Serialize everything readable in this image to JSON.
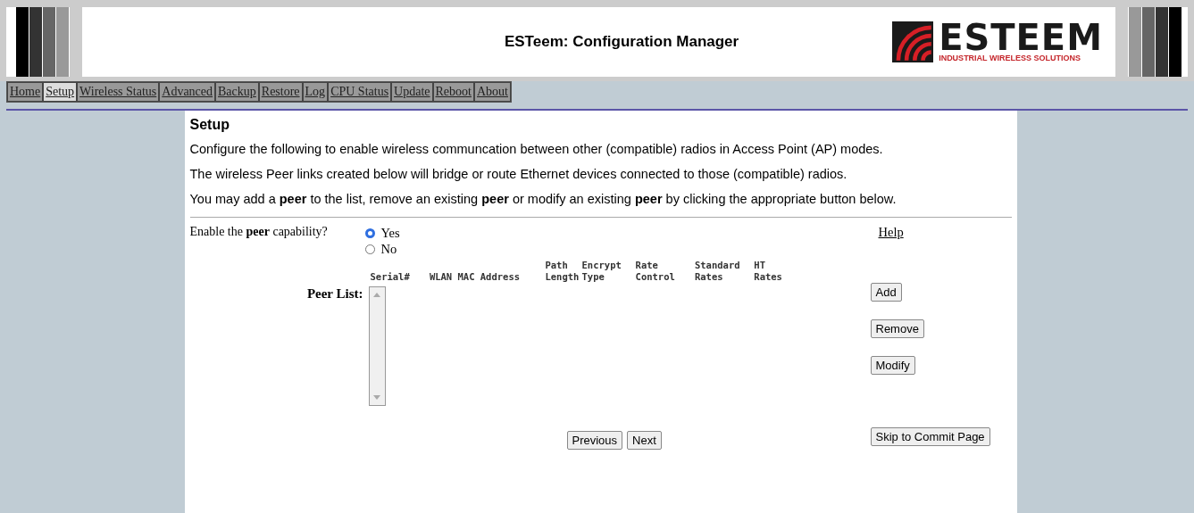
{
  "header": {
    "title": "ESTeem: Configuration Manager",
    "logo_name": "ESTEEM",
    "logo_tagline": "INDUSTRIAL WIRELESS SOLUTIONS"
  },
  "nav": [
    {
      "label": "Home",
      "selected": false
    },
    {
      "label": "Setup",
      "selected": true
    },
    {
      "label": "Wireless Status",
      "selected": false
    },
    {
      "label": "Advanced",
      "selected": false
    },
    {
      "label": "Backup",
      "selected": false
    },
    {
      "label": "Restore",
      "selected": false
    },
    {
      "label": "Log",
      "selected": false
    },
    {
      "label": "CPU Status",
      "selected": false
    },
    {
      "label": "Update",
      "selected": false
    },
    {
      "label": "Reboot",
      "selected": false
    },
    {
      "label": "About",
      "selected": false
    }
  ],
  "page": {
    "heading": "Setup",
    "paragraphs": [
      "Configure the following to enable wireless communcation between other (compatible) radios in Access Point (AP) modes.",
      "The wireless Peer links created below will bridge or route Ethernet devices connected to those (compatible) radios.",
      "You may add a **peer** to the list, remove an existing **peer** or modify an existing **peer** by clicking the appropriate button below."
    ]
  },
  "form": {
    "enable_label": "Enable the **peer** capability?",
    "options": [
      {
        "label": "Yes",
        "selected": true
      },
      {
        "label": "No",
        "selected": false
      }
    ],
    "help_link": "Help",
    "peer_list_label": "Peer List:",
    "columns": [
      "Serial#",
      "WLAN MAC Address",
      "Path Length",
      "Encrypt Type",
      "Rate Control",
      "Standard Rates",
      "HT Rates"
    ],
    "side_buttons": [
      "Add",
      "Remove",
      "Modify"
    ],
    "nav_buttons": [
      "Previous",
      "Next"
    ],
    "commit_button": "Skip to Commit Page"
  }
}
